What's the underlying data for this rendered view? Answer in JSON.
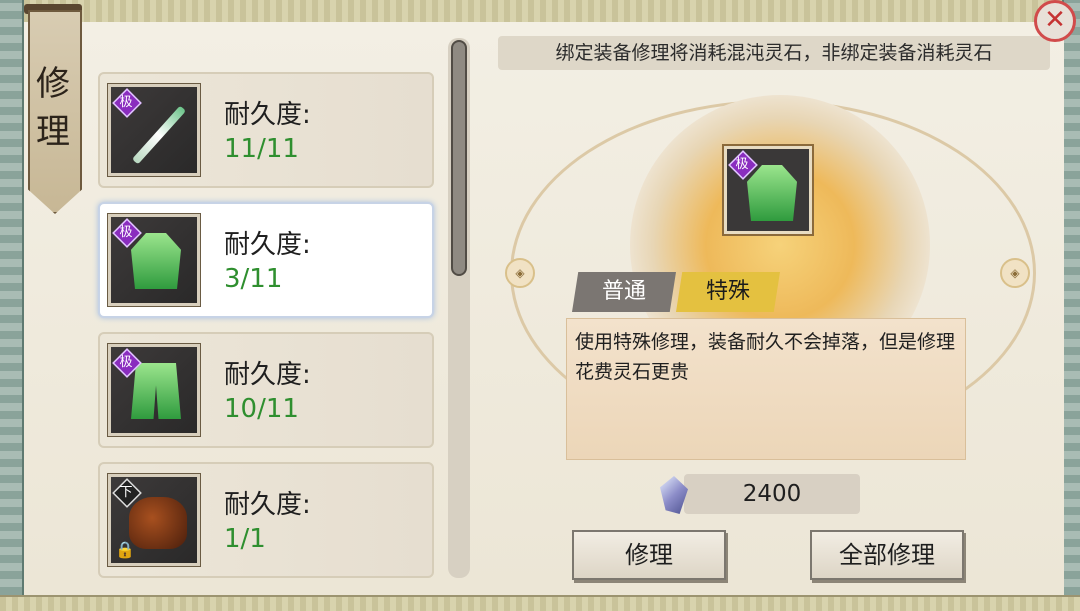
{
  "title": {
    "chars": [
      "修",
      "理"
    ]
  },
  "notice": "绑定装备修理将消耗混沌灵石，非绑定装备消耗灵石",
  "equipment_list": [
    {
      "icon": "sword-icon",
      "grade": "极",
      "durability_label": "耐久度:",
      "durability": "11/11",
      "locked": false,
      "selected": false
    },
    {
      "icon": "green-robe-icon",
      "grade": "极",
      "durability_label": "耐久度:",
      "durability": "3/11",
      "locked": false,
      "selected": true
    },
    {
      "icon": "green-pants-icon",
      "grade": "极",
      "durability_label": "耐久度:",
      "durability": "10/11",
      "locked": false,
      "selected": false
    },
    {
      "icon": "pouch-icon",
      "grade": "下",
      "durability_label": "耐久度:",
      "durability": "1/1",
      "locked": true,
      "selected": false
    }
  ],
  "selected_item": {
    "grade": "极",
    "icon": "green-robe-icon"
  },
  "tabs": [
    {
      "label": "普通",
      "active": false
    },
    {
      "label": "特殊",
      "active": true
    }
  ],
  "description": "使用特殊修理，装备耐久不会掉落，但是修理花费灵石更贵",
  "cost": {
    "icon": "spirit-stone-icon",
    "value": "2400"
  },
  "buttons": {
    "repair": "修理",
    "repair_all": "全部修理"
  },
  "colors": {
    "durability_green": "#2f8f2f",
    "active_tab": "#e4c140",
    "grade_purple": "#8a2dbf"
  }
}
